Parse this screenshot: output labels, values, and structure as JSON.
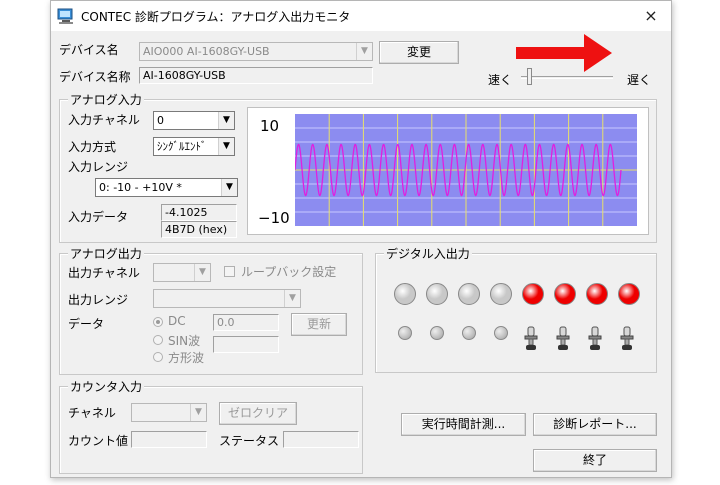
{
  "window": {
    "title": "CONTEC 診断プログラム：アナログ入出力モニタ",
    "close": "×"
  },
  "device": {
    "name_label": "デバイス名",
    "name_value": "AIO000  AI-1608GY-USB",
    "change_button": "変更",
    "model_label": "デバイス名称",
    "model_value": "AI-1608GY-USB"
  },
  "speed": {
    "fast": "速く",
    "slow": "遅く",
    "level": 0.05
  },
  "analog_in": {
    "title": "アナログ入力",
    "channel_label": "入力チャネル",
    "channel_value": "0",
    "mode_label": "入力方式",
    "mode_value": "ｼﾝｸﾞﾙｴﾝﾄﾞ",
    "range_label": "入力レンジ",
    "range_value": "0: -10 - +10V *",
    "data_label": "入力データ",
    "data_value": "-4.1025",
    "data_hex": "4B7D (hex)"
  },
  "graph": {
    "y_top": "10",
    "y_bottom": "−10",
    "cycles": 23,
    "amplitude": 0.48,
    "colors": {
      "bg": "#8c8cf0",
      "grid": "#e8e06a",
      "wave": "#e020e0",
      "hline": "#c8c8ff"
    }
  },
  "analog_out": {
    "title": "アナログ出力",
    "channel_label": "出力チャネル",
    "loopback_label": "ループバック設定",
    "range_label": "出力レンジ",
    "data_label": "データ",
    "dc_label": "DC",
    "dc_value": "0.0",
    "sin_label": "SIN波",
    "square_label": "方形波",
    "update_button": "更新"
  },
  "digital": {
    "title": "デジタル入出力",
    "outputs": [
      "off",
      "off",
      "off",
      "off",
      "on",
      "on",
      "on",
      "on"
    ],
    "colors": {
      "on": "#ee0000",
      "off": "#c8c8c8"
    }
  },
  "counter": {
    "title": "カウンタ入力",
    "channel_label": "チャネル",
    "clear_button": "ゼロクリア",
    "count_label": "カウント値",
    "status_label": "ステータス"
  },
  "buttons": {
    "runtime": "実行時間計測...",
    "report": "診断レポート...",
    "exit": "終了"
  }
}
